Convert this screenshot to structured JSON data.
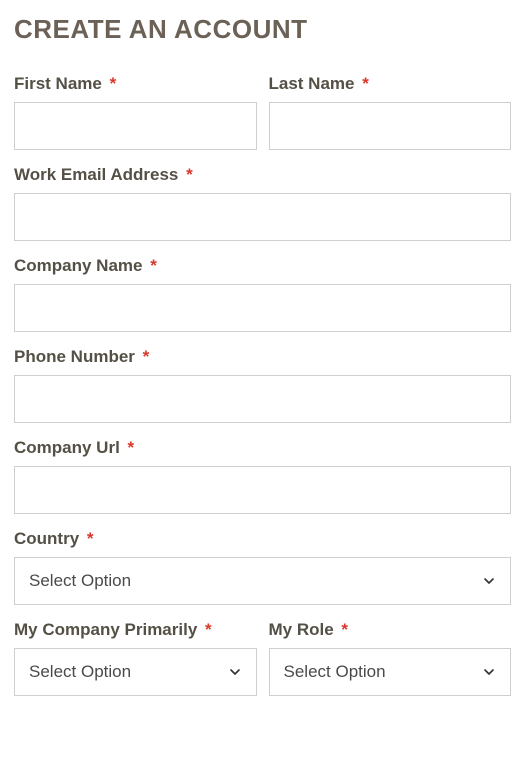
{
  "title": "CREATE AN ACCOUNT",
  "required_mark": "*",
  "fields": {
    "first_name": {
      "label": "First Name",
      "value": ""
    },
    "last_name": {
      "label": "Last Name",
      "value": ""
    },
    "work_email": {
      "label": "Work Email Address",
      "value": ""
    },
    "company_name": {
      "label": "Company Name",
      "value": ""
    },
    "phone": {
      "label": "Phone Number",
      "value": ""
    },
    "company_url": {
      "label": "Company Url",
      "value": ""
    },
    "country": {
      "label": "Country",
      "placeholder": "Select Option"
    },
    "company_primarily": {
      "label": "My Company Primarily",
      "placeholder": "Select Option"
    },
    "my_role": {
      "label": "My Role",
      "placeholder": "Select Option"
    }
  }
}
